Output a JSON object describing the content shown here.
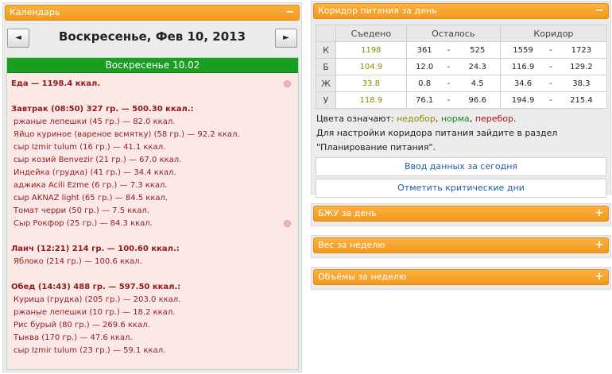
{
  "calendar": {
    "title": "Календарь",
    "toggle": "−",
    "prev": "◄",
    "next": "►",
    "date": "Воскресенье, Фев 10, 2013",
    "day_label": "Воскресенье 10.02",
    "lines": [
      {
        "kind": "hdr",
        "text": "Еда — 1198.4 ккал.",
        "dot": true
      },
      {
        "kind": "gap"
      },
      {
        "kind": "hdr",
        "text": "Завтрак (08:50) 327 гр. — 500.30 ккал.:"
      },
      {
        "kind": "item",
        "text": "ржаные лепешки (45 гр.) — 82.0 ккал."
      },
      {
        "kind": "item",
        "text": "Яйцо куриное (вареное всмятку) (58 гр.) — 92.2 ккал."
      },
      {
        "kind": "item",
        "text": "сыр Izmir tulum (16 гр.) — 41.1 ккал."
      },
      {
        "kind": "item",
        "text": "сыр козий Benvezir (21 гр.) — 67.0 ккал."
      },
      {
        "kind": "item",
        "text": "Индейка (грудка) (41 гр.) — 34.4 ккал."
      },
      {
        "kind": "item",
        "text": "аджика Acili Ezme (6 гр.) — 7.3 ккал."
      },
      {
        "kind": "item",
        "text": "сыр AKNAZ light (65 гр.) — 84.5 ккал."
      },
      {
        "kind": "item",
        "text": "Томат черри (50 гр.) — 7.5 ккал."
      },
      {
        "kind": "item",
        "text": "Сыр Рокфор (25 гр.) — 84.3 ккал.",
        "dot": true
      },
      {
        "kind": "gap"
      },
      {
        "kind": "hdr",
        "text": "Ланч (12:21) 214 гр. — 100.60 ккал.:"
      },
      {
        "kind": "item",
        "text": "Яблоко (214 гр.) — 100.6 ккал."
      },
      {
        "kind": "gap"
      },
      {
        "kind": "hdr",
        "text": "Обед (14:43) 488 гр. — 597.50 ккал.:"
      },
      {
        "kind": "item",
        "text": "Курица (грудка) (205 гр.) — 203.0 ккал."
      },
      {
        "kind": "item",
        "text": "ржаные лепешки (10 гр.) — 18.2 ккал."
      },
      {
        "kind": "item",
        "text": "Рис бурый (80 гр.) — 269.6 ккал."
      },
      {
        "kind": "item",
        "text": "Тыква (170 гр.) — 47.6 ккал."
      },
      {
        "kind": "item",
        "text": "сыр Izmir tulum (23 гр.) — 59.1 ккал."
      }
    ]
  },
  "corridor": {
    "title": "Коридор питания за день",
    "toggle": "−",
    "cols": [
      "Съедено",
      "Осталось",
      "Коридор"
    ],
    "rows": [
      {
        "label": "К",
        "eaten": "1198",
        "left_min": "361",
        "left_max": "525",
        "c_min": "1559",
        "c_max": "1723"
      },
      {
        "label": "Б",
        "eaten": "104.9",
        "left_min": "12.0",
        "left_max": "24.3",
        "c_min": "116.9",
        "c_max": "129.2"
      },
      {
        "label": "Ж",
        "eaten": "33.8",
        "left_min": "0.8",
        "left_max": "4.5",
        "c_min": "34.6",
        "c_max": "38.3"
      },
      {
        "label": "У",
        "eaten": "118.9",
        "left_min": "76.1",
        "left_max": "96.6",
        "c_min": "194.9",
        "c_max": "215.4"
      }
    ],
    "dash": "-",
    "legend_prefix": "Цвета означают:",
    "legend_under": "недобор",
    "legend_norm": "норма",
    "legend_over": "перебор",
    "note": "Для настройки коридора питания зайдите в раздел \"Планирование питания\".",
    "btn_today": "Ввод данных за сегодня",
    "btn_critical": "Отметить критические дни"
  },
  "sections": [
    {
      "title": "БЖУ за день",
      "toggle": "+"
    },
    {
      "title": "Вес за неделю",
      "toggle": "+"
    },
    {
      "title": "Объёмы за неделю",
      "toggle": "+"
    }
  ],
  "colors": {
    "accent": "#f39a1e",
    "day_bar": "#1a9e22",
    "link": "#1c5fa8",
    "meal_text": "#8b1c1c"
  }
}
